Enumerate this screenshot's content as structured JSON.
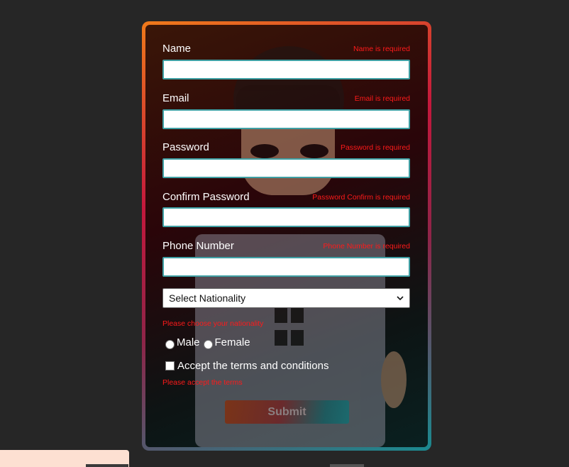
{
  "form": {
    "name": {
      "label": "Name",
      "error": "Name is required",
      "value": ""
    },
    "email": {
      "label": "Email",
      "error": "Email is required",
      "value": ""
    },
    "password": {
      "label": "Password",
      "error": "Password is required",
      "value": ""
    },
    "confirm_password": {
      "label": "Confirm Password",
      "error": "Password Confirm is required",
      "value": ""
    },
    "phone": {
      "label": "Phone Number",
      "error": "Phone Number is required",
      "value": ""
    },
    "nationality": {
      "selected": "Select Nationality",
      "error": "Please choose your nationality"
    },
    "gender": {
      "male_label": "Male",
      "female_label": "Female"
    },
    "terms": {
      "label": "Accept the terms and conditions",
      "error": "Please accept the terms"
    },
    "submit_label": "Submit"
  },
  "colors": {
    "error": "#ff1a1a",
    "input_border": "#3fa0a4",
    "background": "#262626"
  }
}
